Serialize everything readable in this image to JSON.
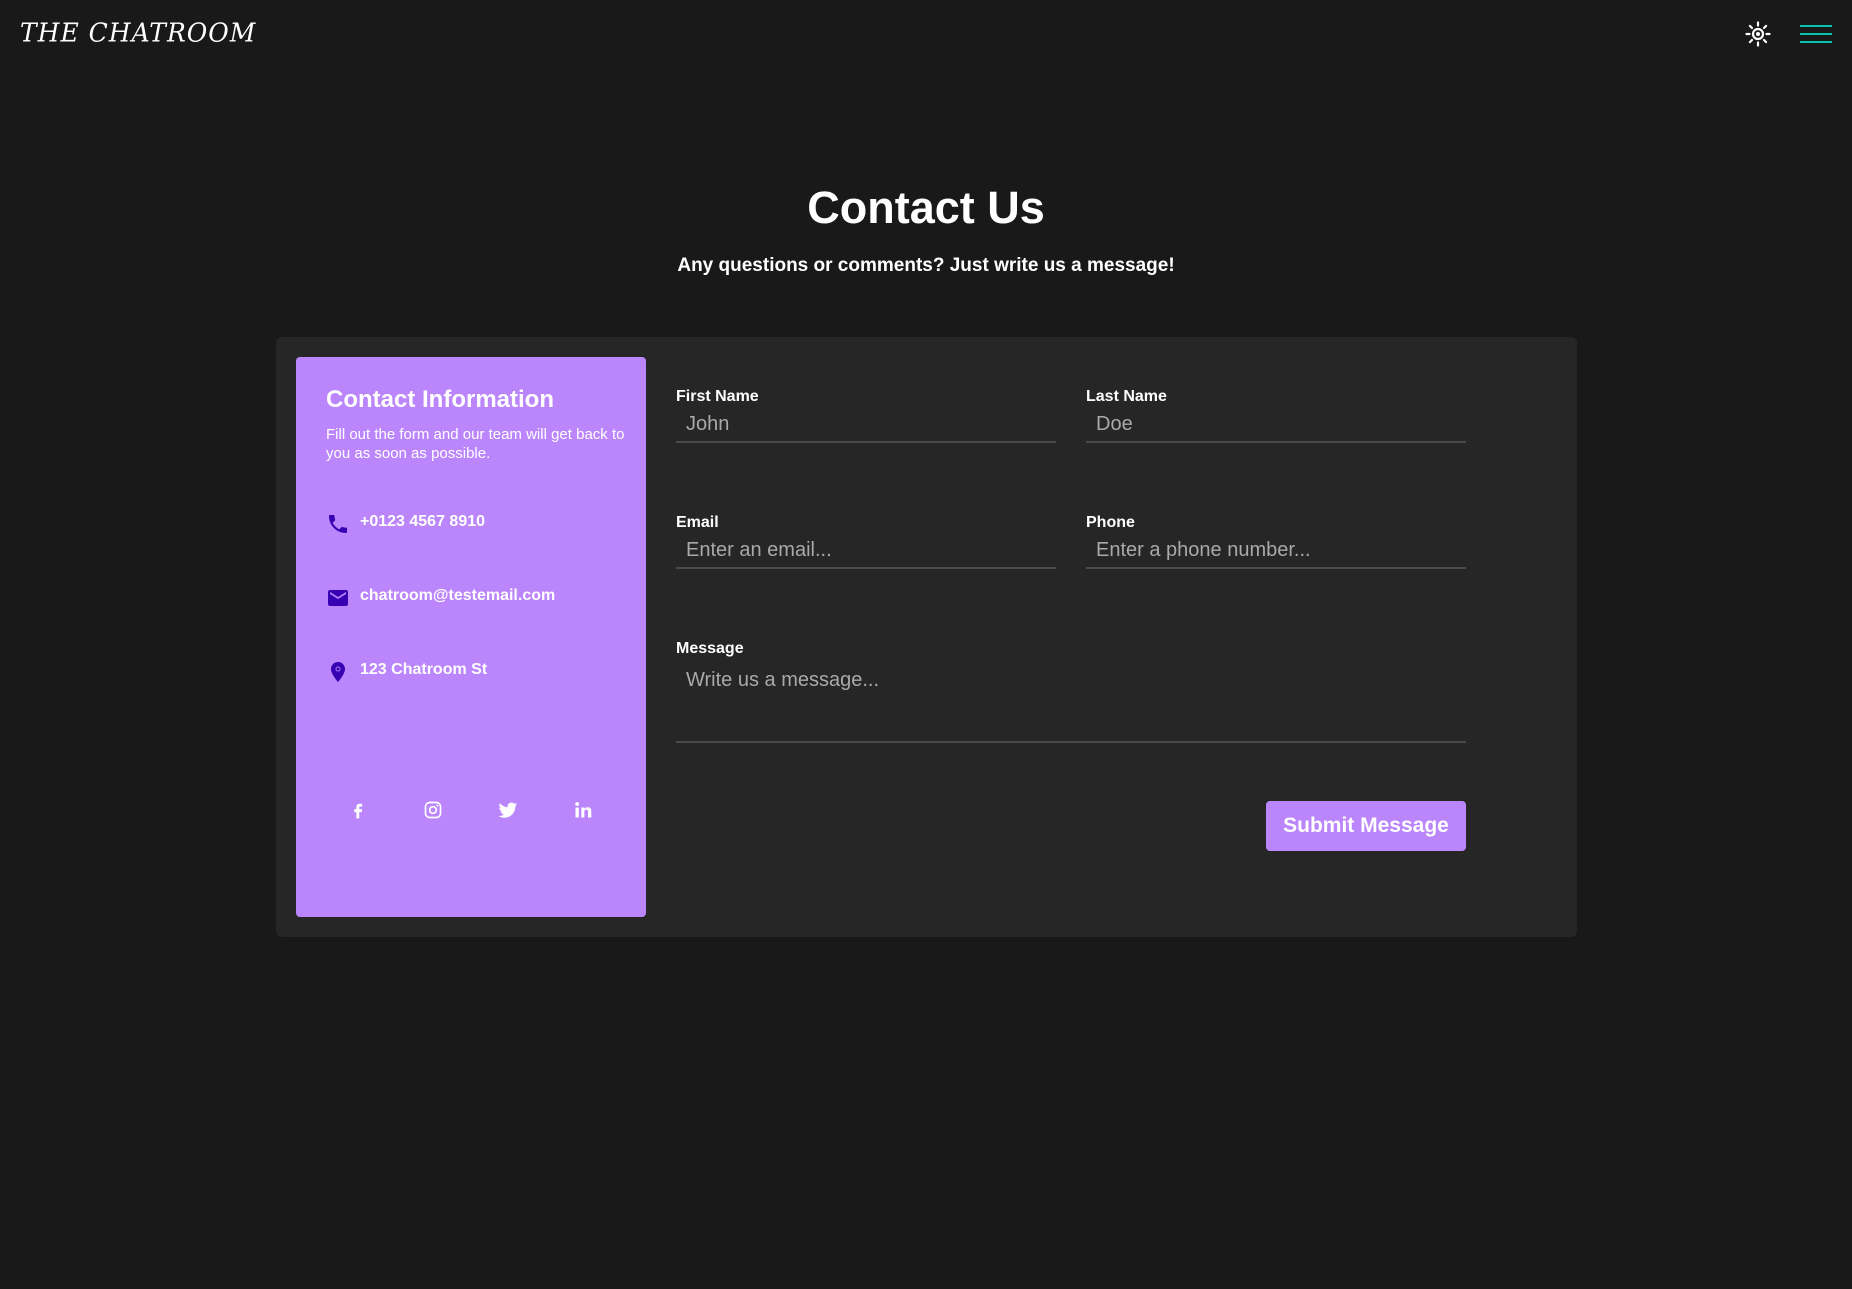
{
  "header": {
    "logo": "THE CHATROOM",
    "theme_icon": "sun-icon",
    "menu_icon": "hamburger-menu-icon",
    "menu_color": "#03dac5"
  },
  "hero": {
    "title": "Contact Us",
    "subtitle": "Any questions or comments? Just write us a message!"
  },
  "contact_info": {
    "title": "Contact Information",
    "description": "Fill out the form and our team will get back to you as soon as possible.",
    "phone": "+0123 4567 8910",
    "email": "chatroom@testemail.com",
    "address": "123 Chatroom St",
    "icon_color": "#3700b3",
    "panel_color": "#bb86fc",
    "socials": [
      "facebook-icon",
      "instagram-icon",
      "twitter-icon",
      "linkedin-icon"
    ]
  },
  "form": {
    "first_name": {
      "label": "First Name",
      "placeholder": "John",
      "value": ""
    },
    "last_name": {
      "label": "Last Name",
      "placeholder": "Doe",
      "value": ""
    },
    "email": {
      "label": "Email",
      "placeholder": "Enter an email...",
      "value": ""
    },
    "phone": {
      "label": "Phone",
      "placeholder": "Enter a phone number...",
      "value": ""
    },
    "message": {
      "label": "Message",
      "placeholder": "Write us a message...",
      "value": ""
    },
    "submit_label": "Submit Message"
  }
}
